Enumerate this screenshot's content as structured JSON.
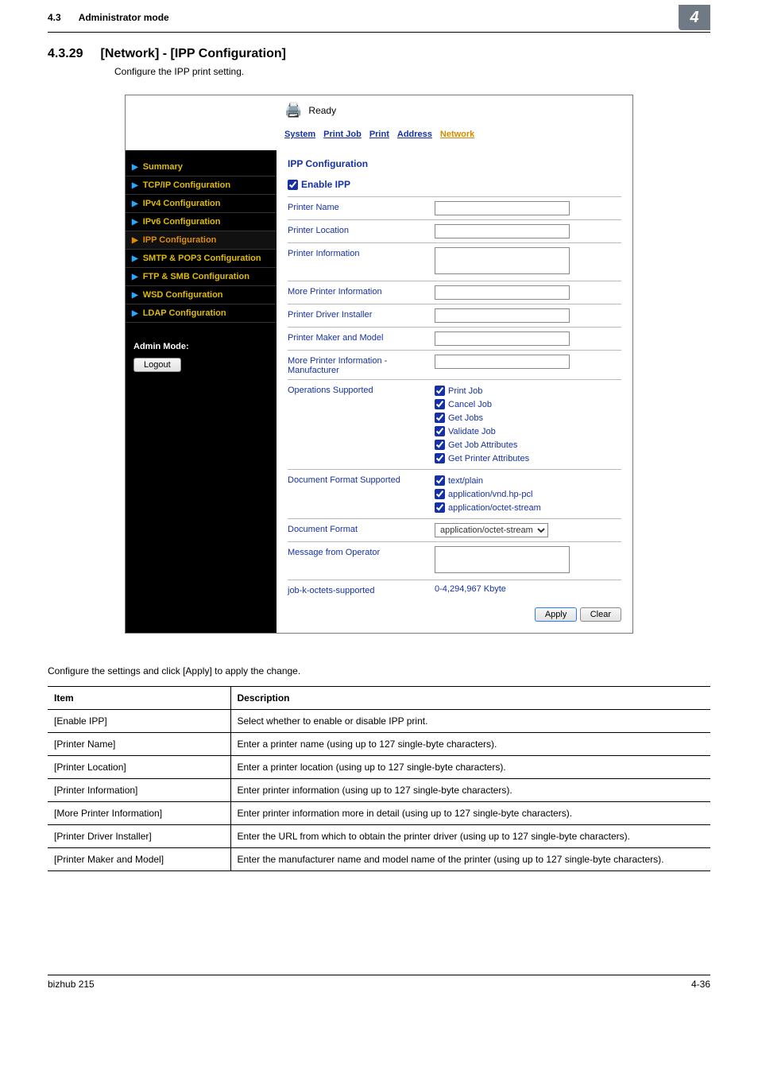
{
  "header": {
    "section_num": "4.3",
    "section_title": "Administrator mode",
    "badge": "4"
  },
  "section": {
    "num": "4.3.29",
    "title": "[Network] - [IPP Configuration]",
    "intro": "Configure the IPP print setting."
  },
  "app": {
    "ready_label": "Ready",
    "tabs": [
      "System",
      "Print Job",
      "Print",
      "Address",
      "Network"
    ],
    "active_tab_index": 4,
    "sidebar": {
      "items": [
        {
          "label": "Summary"
        },
        {
          "label": "TCP/IP Configuration"
        },
        {
          "label": "IPv4 Configuration"
        },
        {
          "label": "IPv6 Configuration"
        },
        {
          "label": "IPP Configuration",
          "active": true
        },
        {
          "label": "SMTP & POP3 Configuration"
        },
        {
          "label": "FTP & SMB Configuration"
        },
        {
          "label": "WSD Configuration"
        },
        {
          "label": "LDAP Configuration"
        }
      ],
      "admin_mode_label": "Admin Mode:",
      "logout_label": "Logout"
    },
    "content": {
      "heading": "IPP Configuration",
      "enable_ipp_label": "Enable IPP",
      "enable_ipp_checked": true,
      "rows": [
        {
          "label": "Printer Name",
          "type": "text"
        },
        {
          "label": "Printer Location",
          "type": "text"
        },
        {
          "label": "Printer Information",
          "type": "textarea"
        },
        {
          "label": "More Printer Information",
          "type": "text"
        },
        {
          "label": "Printer Driver Installer",
          "type": "text"
        },
        {
          "label": "Printer Maker and Model",
          "type": "text"
        },
        {
          "label": "More Printer Information - Manufacturer",
          "type": "text"
        }
      ],
      "ops_label": "Operations Supported",
      "ops": [
        "Print Job",
        "Cancel Job",
        "Get Jobs",
        "Validate Job",
        "Get Job Attributes",
        "Get Printer Attributes"
      ],
      "docfmt_label": "Document Format Supported",
      "docfmts": [
        "text/plain",
        "application/vnd.hp-pcl",
        "application/octet-stream"
      ],
      "docfmt_sel_label": "Document Format",
      "docfmt_sel_value": "application/octet-stream",
      "msg_label": "Message from Operator",
      "job_k_label": "job-k-octets-supported",
      "job_k_value": "0-4,294,967 Kbyte",
      "apply_label": "Apply",
      "clear_label": "Clear"
    }
  },
  "desc": {
    "intro": "Configure the settings and click [Apply] to apply the change.",
    "head_item": "Item",
    "head_desc": "Description",
    "rows": [
      {
        "item": "[Enable IPP]",
        "desc": "Select whether to enable or disable IPP print."
      },
      {
        "item": "[Printer Name]",
        "desc": "Enter a printer name (using up to 127 single-byte characters)."
      },
      {
        "item": "[Printer Location]",
        "desc": "Enter a printer location (using up to 127 single-byte characters)."
      },
      {
        "item": "[Printer Information]",
        "desc": "Enter printer information (using up to 127 single-byte characters)."
      },
      {
        "item": "[More Printer Information]",
        "desc": "Enter printer information more in detail (using up to 127 single-byte characters)."
      },
      {
        "item": "[Printer Driver Installer]",
        "desc": "Enter the URL from which to obtain the printer driver (using up to 127 single-byte characters)."
      },
      {
        "item": "[Printer Maker and Model]",
        "desc": "Enter the manufacturer name and model name of the printer (using up to 127 single-byte characters)."
      }
    ]
  },
  "footer": {
    "left": "bizhub 215",
    "right": "4-36"
  }
}
